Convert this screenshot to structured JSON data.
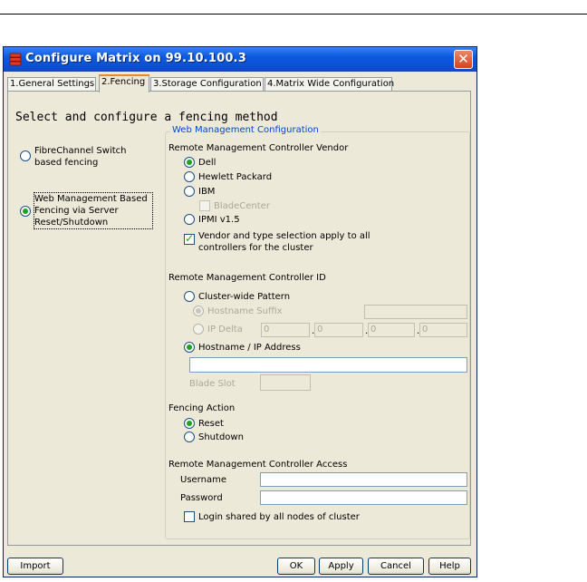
{
  "window": {
    "title": "Configure Matrix on 99.10.100.3",
    "close_label": "✕"
  },
  "tabs": [
    {
      "label": "1.General Settings"
    },
    {
      "label": "2.Fencing"
    },
    {
      "label": "3.Storage Configuration"
    },
    {
      "label": "4.Matrix Wide Configuration"
    }
  ],
  "heading": "Select and configure a fencing method",
  "fencing_methods": {
    "fibre": "FibreChannel Switch based fencing",
    "web": "Web Management Based Fencing via Server Reset/Shutdown"
  },
  "web_config": {
    "group_title": "Web Management Configuration",
    "vendor_label": "Remote Management Controller Vendor",
    "vendors": {
      "dell": "Dell",
      "hp": "Hewlett Packard",
      "ibm": "IBM",
      "bladecenter": "BladeCenter",
      "ipmi": "IPMI v1.5"
    },
    "vendor_apply_all": "Vendor and type selection apply to all controllers for the cluster",
    "id_label": "Remote Management Controller ID",
    "cluster_pattern": "Cluster-wide Pattern",
    "hostname_suffix": "Hostname Suffix",
    "ip_delta": "IP Delta",
    "ip_delta_values": [
      "0",
      "0",
      "0",
      "0"
    ],
    "hostname_ip": "Hostname / IP Address",
    "hostname_ip_value": "",
    "blade_slot": "Blade Slot",
    "action_label": "Fencing Action",
    "reset": "Reset",
    "shutdown": "Shutdown",
    "access_label": "Remote Management Controller Access",
    "username": "Username",
    "password": "Password",
    "login_shared": "Login shared by all nodes of cluster"
  },
  "buttons": {
    "import": "Import",
    "ok": "OK",
    "apply": "Apply",
    "cancel": "Cancel",
    "help": "Help"
  },
  "colors": {
    "titlebar": "#0a5ae0",
    "group_title": "#0046d5",
    "radio_selected": "#21a121"
  }
}
